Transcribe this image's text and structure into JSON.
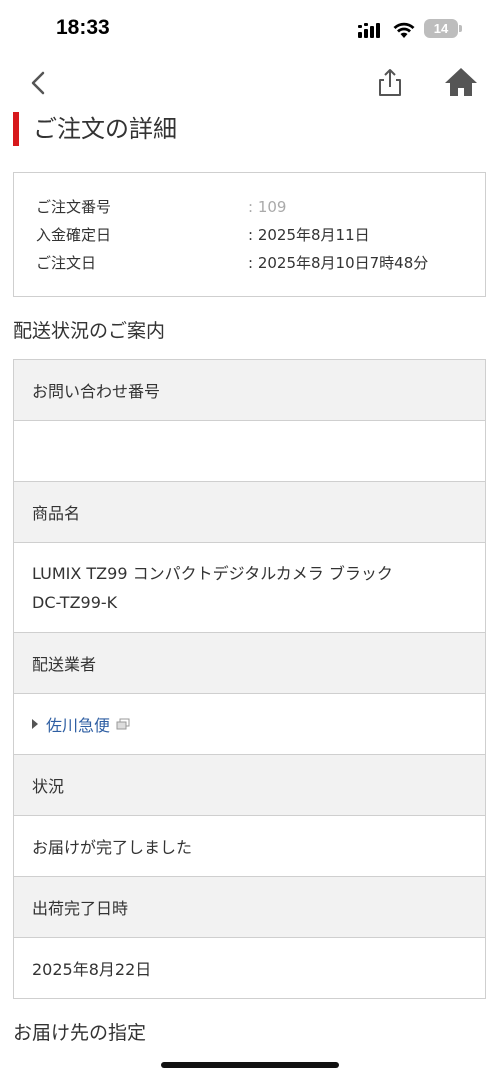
{
  "status_bar": {
    "time": "18:33",
    "battery": "14"
  },
  "nav": {
    "back_icon": "chevron-left-icon",
    "share_icon": "share-icon",
    "home_icon": "home-icon"
  },
  "page": {
    "title": "ご注文の詳細",
    "accent_color": "#d7191c"
  },
  "order_summary": {
    "order_number_label": "ご注文番号",
    "order_number_value": ": 109",
    "payment_date_label": "入金確定日",
    "payment_date_value": ": 2025年8月11日",
    "order_date_label": "ご注文日",
    "order_date_value": ": 2025年8月10日7時48分"
  },
  "shipping": {
    "heading": "配送状況のご案内",
    "inquiry_number_label": "お問い合わせ番号",
    "product_name_label": "商品名",
    "product_name_line1": "LUMIX TZ99 コンパクトデジタルカメラ ブラック",
    "product_name_line2": "DC-TZ99-K",
    "carrier_label": "配送業者",
    "carrier_value": "佐川急便",
    "status_label": "状況",
    "status_value": "お届けが完了しました",
    "ship_date_label": "出荷完了日時",
    "ship_date_value": "2025年8月22日",
    "link_color": "#2f5fa3"
  },
  "delivery": {
    "heading": "お届け先の指定"
  }
}
